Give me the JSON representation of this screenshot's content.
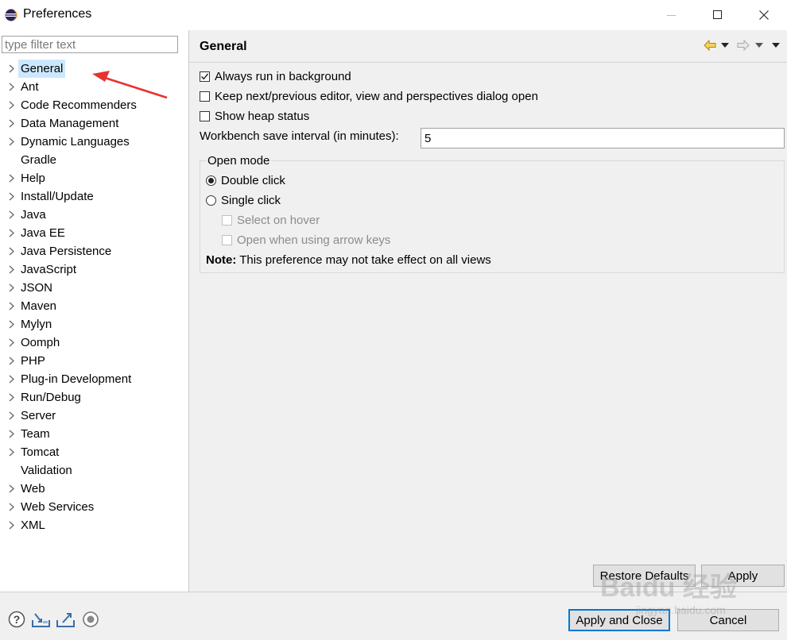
{
  "window": {
    "title": "Preferences"
  },
  "sidebar": {
    "filter_placeholder": "type filter text",
    "items": [
      {
        "label": "General",
        "expandable": true,
        "selected": true
      },
      {
        "label": "Ant",
        "expandable": true
      },
      {
        "label": "Code Recommenders",
        "expandable": true
      },
      {
        "label": "Data Management",
        "expandable": true
      },
      {
        "label": "Dynamic Languages",
        "expandable": true
      },
      {
        "label": "Gradle",
        "expandable": false
      },
      {
        "label": "Help",
        "expandable": true
      },
      {
        "label": "Install/Update",
        "expandable": true
      },
      {
        "label": "Java",
        "expandable": true
      },
      {
        "label": "Java EE",
        "expandable": true
      },
      {
        "label": "Java Persistence",
        "expandable": true
      },
      {
        "label": "JavaScript",
        "expandable": true
      },
      {
        "label": "JSON",
        "expandable": true
      },
      {
        "label": "Maven",
        "expandable": true
      },
      {
        "label": "Mylyn",
        "expandable": true
      },
      {
        "label": "Oomph",
        "expandable": true
      },
      {
        "label": "PHP",
        "expandable": true
      },
      {
        "label": "Plug-in Development",
        "expandable": true
      },
      {
        "label": "Run/Debug",
        "expandable": true
      },
      {
        "label": "Server",
        "expandable": true
      },
      {
        "label": "Team",
        "expandable": true
      },
      {
        "label": "Tomcat",
        "expandable": true
      },
      {
        "label": "Validation",
        "expandable": false
      },
      {
        "label": "Web",
        "expandable": true
      },
      {
        "label": "Web Services",
        "expandable": true
      },
      {
        "label": "XML",
        "expandable": true
      }
    ]
  },
  "page": {
    "title": "General",
    "always_run_in_background": "Always run in background",
    "always_run_checked": true,
    "keep_dialog_open": "Keep next/previous editor, view and perspectives dialog open",
    "keep_dialog_checked": false,
    "show_heap_status": "Show heap status",
    "show_heap_checked": false,
    "interval_label": "Workbench save interval (in minutes):",
    "interval_value": "5",
    "open_mode": {
      "title": "Open mode",
      "double_click": "Double click",
      "single_click": "Single click",
      "selected": "double_click",
      "select_on_hover": "Select on hover",
      "open_arrow_keys": "Open when using arrow keys",
      "note_label": "Note:",
      "note_text": " This preference may not take effect on all views"
    },
    "restore_defaults": "Restore Defaults",
    "apply": "Apply"
  },
  "footer": {
    "apply_and_close": "Apply and Close",
    "cancel": "Cancel",
    "icons": [
      "help-icon",
      "import-icon",
      "export-icon",
      "record-icon"
    ]
  },
  "watermark": {
    "logo": "Baidu 经验",
    "url": "jingyan.baidu.com"
  },
  "colors": {
    "selection": "#cce8ff",
    "annotation_arrow": "#e8322e",
    "default_button_border": "#0078d7",
    "nav_back_arrow": "#d4a017"
  }
}
